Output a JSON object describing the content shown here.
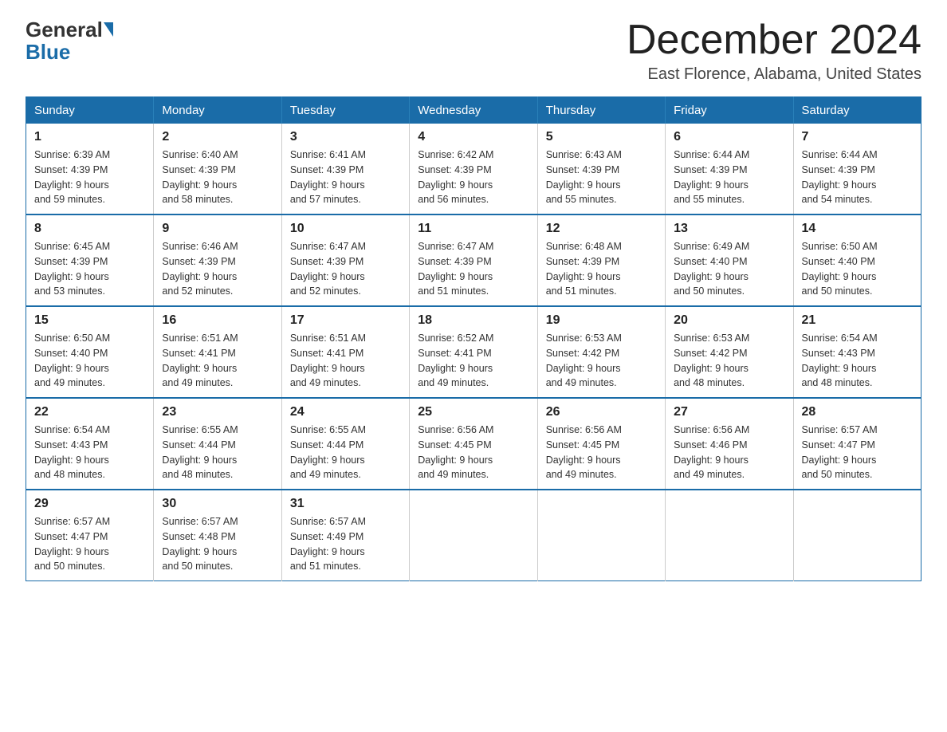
{
  "header": {
    "logo_general": "General",
    "logo_blue": "Blue",
    "month_title": "December 2024",
    "location": "East Florence, Alabama, United States"
  },
  "days_of_week": [
    "Sunday",
    "Monday",
    "Tuesday",
    "Wednesday",
    "Thursday",
    "Friday",
    "Saturday"
  ],
  "weeks": [
    [
      {
        "day": "1",
        "sunrise": "6:39 AM",
        "sunset": "4:39 PM",
        "daylight": "9 hours and 59 minutes."
      },
      {
        "day": "2",
        "sunrise": "6:40 AM",
        "sunset": "4:39 PM",
        "daylight": "9 hours and 58 minutes."
      },
      {
        "day": "3",
        "sunrise": "6:41 AM",
        "sunset": "4:39 PM",
        "daylight": "9 hours and 57 minutes."
      },
      {
        "day": "4",
        "sunrise": "6:42 AM",
        "sunset": "4:39 PM",
        "daylight": "9 hours and 56 minutes."
      },
      {
        "day": "5",
        "sunrise": "6:43 AM",
        "sunset": "4:39 PM",
        "daylight": "9 hours and 55 minutes."
      },
      {
        "day": "6",
        "sunrise": "6:44 AM",
        "sunset": "4:39 PM",
        "daylight": "9 hours and 55 minutes."
      },
      {
        "day": "7",
        "sunrise": "6:44 AM",
        "sunset": "4:39 PM",
        "daylight": "9 hours and 54 minutes."
      }
    ],
    [
      {
        "day": "8",
        "sunrise": "6:45 AM",
        "sunset": "4:39 PM",
        "daylight": "9 hours and 53 minutes."
      },
      {
        "day": "9",
        "sunrise": "6:46 AM",
        "sunset": "4:39 PM",
        "daylight": "9 hours and 52 minutes."
      },
      {
        "day": "10",
        "sunrise": "6:47 AM",
        "sunset": "4:39 PM",
        "daylight": "9 hours and 52 minutes."
      },
      {
        "day": "11",
        "sunrise": "6:47 AM",
        "sunset": "4:39 PM",
        "daylight": "9 hours and 51 minutes."
      },
      {
        "day": "12",
        "sunrise": "6:48 AM",
        "sunset": "4:39 PM",
        "daylight": "9 hours and 51 minutes."
      },
      {
        "day": "13",
        "sunrise": "6:49 AM",
        "sunset": "4:40 PM",
        "daylight": "9 hours and 50 minutes."
      },
      {
        "day": "14",
        "sunrise": "6:50 AM",
        "sunset": "4:40 PM",
        "daylight": "9 hours and 50 minutes."
      }
    ],
    [
      {
        "day": "15",
        "sunrise": "6:50 AM",
        "sunset": "4:40 PM",
        "daylight": "9 hours and 49 minutes."
      },
      {
        "day": "16",
        "sunrise": "6:51 AM",
        "sunset": "4:41 PM",
        "daylight": "9 hours and 49 minutes."
      },
      {
        "day": "17",
        "sunrise": "6:51 AM",
        "sunset": "4:41 PM",
        "daylight": "9 hours and 49 minutes."
      },
      {
        "day": "18",
        "sunrise": "6:52 AM",
        "sunset": "4:41 PM",
        "daylight": "9 hours and 49 minutes."
      },
      {
        "day": "19",
        "sunrise": "6:53 AM",
        "sunset": "4:42 PM",
        "daylight": "9 hours and 49 minutes."
      },
      {
        "day": "20",
        "sunrise": "6:53 AM",
        "sunset": "4:42 PM",
        "daylight": "9 hours and 48 minutes."
      },
      {
        "day": "21",
        "sunrise": "6:54 AM",
        "sunset": "4:43 PM",
        "daylight": "9 hours and 48 minutes."
      }
    ],
    [
      {
        "day": "22",
        "sunrise": "6:54 AM",
        "sunset": "4:43 PM",
        "daylight": "9 hours and 48 minutes."
      },
      {
        "day": "23",
        "sunrise": "6:55 AM",
        "sunset": "4:44 PM",
        "daylight": "9 hours and 48 minutes."
      },
      {
        "day": "24",
        "sunrise": "6:55 AM",
        "sunset": "4:44 PM",
        "daylight": "9 hours and 49 minutes."
      },
      {
        "day": "25",
        "sunrise": "6:56 AM",
        "sunset": "4:45 PM",
        "daylight": "9 hours and 49 minutes."
      },
      {
        "day": "26",
        "sunrise": "6:56 AM",
        "sunset": "4:45 PM",
        "daylight": "9 hours and 49 minutes."
      },
      {
        "day": "27",
        "sunrise": "6:56 AM",
        "sunset": "4:46 PM",
        "daylight": "9 hours and 49 minutes."
      },
      {
        "day": "28",
        "sunrise": "6:57 AM",
        "sunset": "4:47 PM",
        "daylight": "9 hours and 50 minutes."
      }
    ],
    [
      {
        "day": "29",
        "sunrise": "6:57 AM",
        "sunset": "4:47 PM",
        "daylight": "9 hours and 50 minutes."
      },
      {
        "day": "30",
        "sunrise": "6:57 AM",
        "sunset": "4:48 PM",
        "daylight": "9 hours and 50 minutes."
      },
      {
        "day": "31",
        "sunrise": "6:57 AM",
        "sunset": "4:49 PM",
        "daylight": "9 hours and 51 minutes."
      },
      null,
      null,
      null,
      null
    ]
  ],
  "labels": {
    "sunrise": "Sunrise:",
    "sunset": "Sunset:",
    "daylight": "Daylight:"
  }
}
